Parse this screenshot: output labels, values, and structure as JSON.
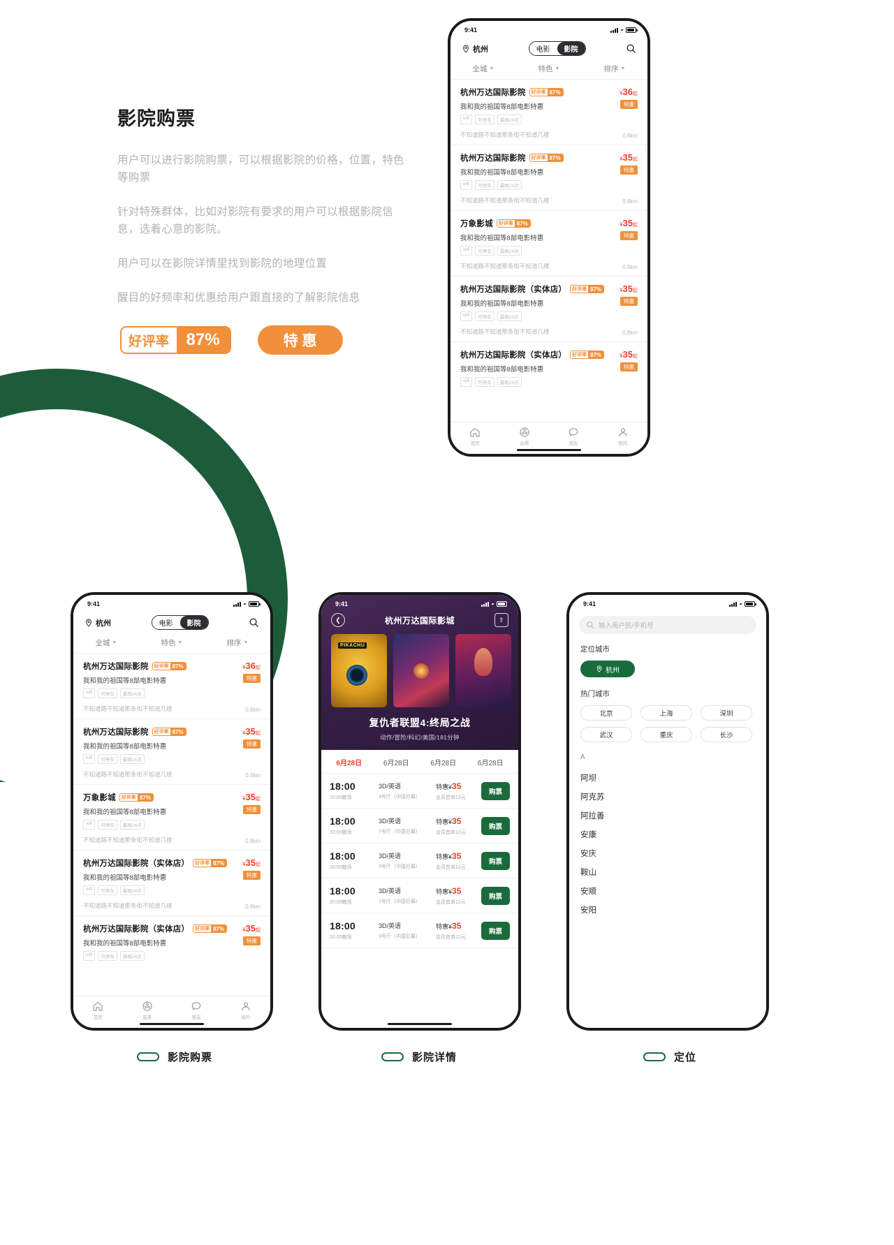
{
  "intro": {
    "title": "影院购票",
    "paragraphs": [
      "用户可以进行影院购票，可以根据影院的价格，位置，特色等购票",
      "针对特殊群体，比如对影院有要求的用户可以根据影院信息，选着心意的影院。",
      "用户可以在影院详情里找到影院的地理位置",
      "醒目的好频率和优惠给用户跟直接的了解影院信息"
    ],
    "rate_badge_label": "好评率",
    "rate_badge_value": "87%",
    "sale_badge": "特惠"
  },
  "colors": {
    "orange": "#f0903b",
    "green": "#1a6b3c",
    "dark_green_ring": "#1d5c3a",
    "red_price": "#e8412c",
    "dark_nav": "#2b2f33"
  },
  "status_bar": {
    "time": "9:41"
  },
  "cinema_list": {
    "city": "杭州",
    "pin_icon": "location-pin-icon",
    "search_icon": "search-icon",
    "segment": {
      "left": "电影",
      "right": "影院",
      "active": "影院"
    },
    "filters": [
      "全城",
      "特色",
      "排序"
    ],
    "tags": [
      "wifi",
      "可停车",
      "最晚24点"
    ],
    "rate_label": "好评率",
    "sale_label": "特惠",
    "price_suffix": "起",
    "currency": "¥",
    "rows": [
      {
        "name": "杭州万达国际影院",
        "rate": "87%",
        "sub": "我和我的祖国等8部电影特惠",
        "addr": "不知道路不知道那条街不知道几楼",
        "dist": "0.8km",
        "price": "36"
      },
      {
        "name": "杭州万达国际影院",
        "rate": "87%",
        "sub": "我和我的祖国等8部电影特惠",
        "addr": "不知道路不知道那条街不知道几楼",
        "dist": "0.8km",
        "price": "35"
      },
      {
        "name": "万象影城",
        "rate": "87%",
        "sub": "我和我的祖国等8部电影特惠",
        "addr": "不知道路不知道那条街不知道几楼",
        "dist": "0.8km",
        "price": "35"
      },
      {
        "name": "杭州万达国际影院（实体店）",
        "rate": "87%",
        "sub": "我和我的祖国等8部电影特惠",
        "addr": "不知道路不知道那条街不知道几楼",
        "dist": "0.8km",
        "price": "35"
      },
      {
        "name": "杭州万达国际影院（实体店）",
        "rate": "87%",
        "sub": "我和我的祖国等8部电影特惠",
        "addr": "",
        "dist": "",
        "price": "35"
      }
    ],
    "tabbar": [
      {
        "label": "首页",
        "icon": "home-icon"
      },
      {
        "label": "选票",
        "icon": "film-reel-icon"
      },
      {
        "label": "朋友",
        "icon": "chat-bubble-icon"
      },
      {
        "label": "我的",
        "icon": "user-icon"
      }
    ]
  },
  "cinema_detail": {
    "back_icon": "back-chevron-icon",
    "share_icon": "share-icon",
    "title": "杭州万达国际影城",
    "posters": [
      "POKEMON DETECTIVE PIKACHU",
      "复仇者联盟4",
      "惊奇队长"
    ],
    "poster1_badge": "PIKACHU",
    "movie_title": "复仇者联盟4:终局之战",
    "movie_meta": "动作/冒险/科幻/美国/181分钟",
    "dates": [
      "6月28日",
      "6月28日",
      "6月28日",
      "6月28日"
    ],
    "active_date_index": 0,
    "buy_label": "购票",
    "showtimes": [
      {
        "time": "18:00",
        "end": "20:00散场",
        "format": "3D/英语",
        "hall": "3号厅（中国巨幕）",
        "price_label": "特惠¥",
        "price": "35",
        "member": "会员首单12元"
      },
      {
        "time": "18:00",
        "end": "20:00散场",
        "format": "3D/英语",
        "hall": "7号厅（中国巨幕）",
        "price_label": "特惠¥",
        "price": "35",
        "member": "会员首单12元"
      },
      {
        "time": "18:00",
        "end": "20:00散场",
        "format": "3D/英语",
        "hall": "3号厅（中国巨幕）",
        "price_label": "特惠¥",
        "price": "35",
        "member": "会员首单12元"
      },
      {
        "time": "18:00",
        "end": "20:00散场",
        "format": "3D/英语",
        "hall": "7号厅（中国巨幕）",
        "price_label": "特惠¥",
        "price": "35",
        "member": "会员首单12元"
      },
      {
        "time": "18:00",
        "end": "20:00散场",
        "format": "3D/英语",
        "hall": "3号厅（中国巨幕）",
        "price_label": "特惠¥",
        "price": "35",
        "member": "会员首单12元"
      }
    ]
  },
  "location": {
    "search_placeholder": "输入用户民/手机号",
    "search_icon": "search-icon",
    "located_title": "定位城市",
    "located_city": "杭州",
    "located_icon": "location-pin-icon",
    "hot_title": "热门城市",
    "hot_cities": [
      "北京",
      "上海",
      "深圳",
      "武汉",
      "重庆",
      "长沙"
    ],
    "index_letter": "A",
    "cities": [
      "阿坝",
      "阿克苏",
      "阿拉善",
      "安康",
      "安庆",
      "鞍山",
      "安顺",
      "安阳"
    ]
  },
  "captions": [
    {
      "text": "影院购票"
    },
    {
      "text": "影院详情"
    },
    {
      "text": "定位"
    }
  ]
}
